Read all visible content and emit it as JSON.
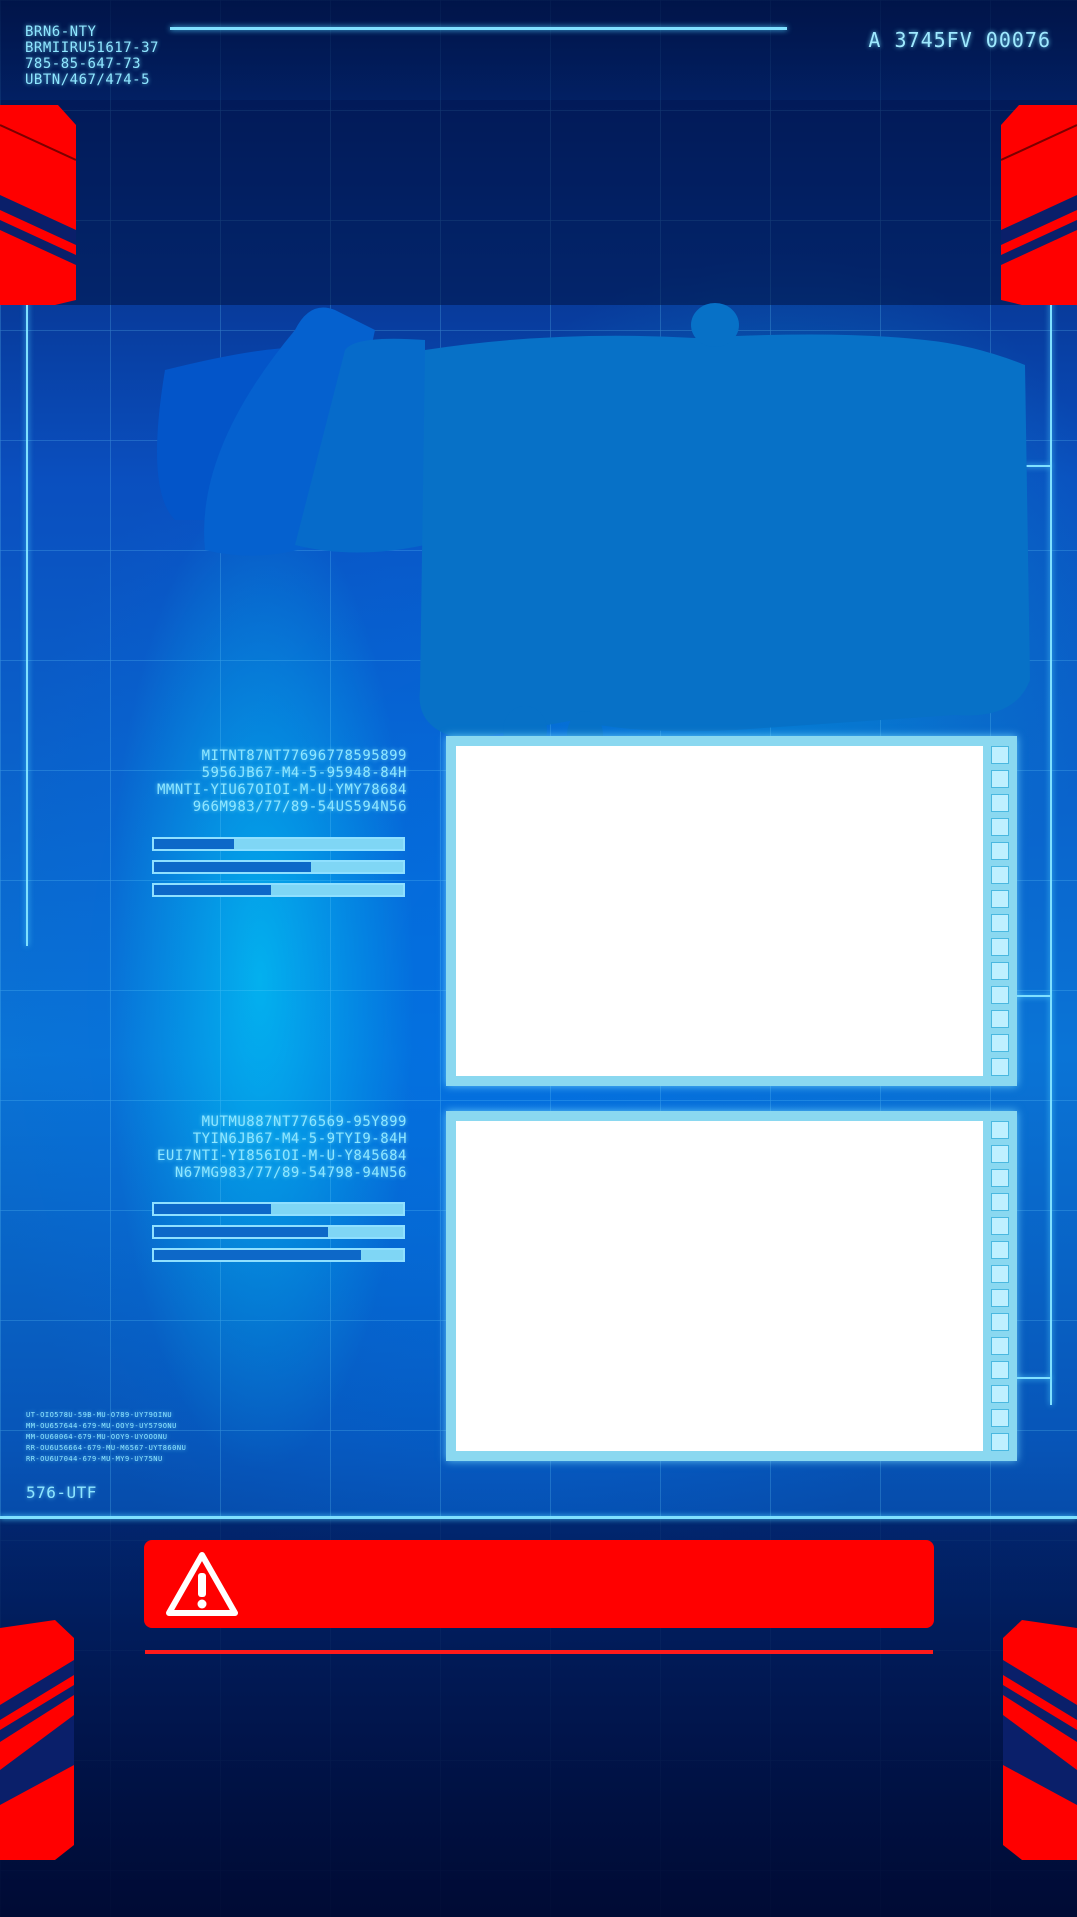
{
  "header": {
    "codes": [
      "BRN6-NTY",
      "BRMIIRU51617-37",
      "785-85-647-73",
      "UBTN/467/474-5"
    ],
    "id": "A 3745FV 00076"
  },
  "block1": {
    "lines": [
      "MITNT87NT77696778595899",
      "5956JB67-M4-5-95948-84H",
      "MMNTI-YIU67OIOI-M-U-YMY78684",
      "966M983/77/89-54US594N56"
    ],
    "bars": [
      0.32,
      0.63,
      0.47
    ]
  },
  "block2": {
    "lines": [
      "MUTMU887NT776569-95Y899",
      "TYIN6JB67-M4-5-9TYI9-84H",
      "EUI7NTI-YI856IOI-M-U-Y845684",
      "N67MG983/77/89-54798-94N56"
    ],
    "bars": [
      0.47,
      0.7,
      0.83
    ]
  },
  "small_codes": [
    "UT-OIO578U-59B-MU-O789-UY79OINU",
    "MM-OU657644-679-MU-OOY9-UY579ONU",
    "MM-OU60064-679-MU-OOY9-UYOOONU",
    "RR-OU6U56664-679-MU-M6567-UYT860NU",
    "RR-OU6U7044-679-MU-MY9-UY75NU"
  ],
  "footer_code": "576-UTF",
  "colors": {
    "accent": "#7fe0ff",
    "alert": "#ff0000",
    "redaction": "#0771c7"
  },
  "warning_icon": "warning-triangle-icon"
}
